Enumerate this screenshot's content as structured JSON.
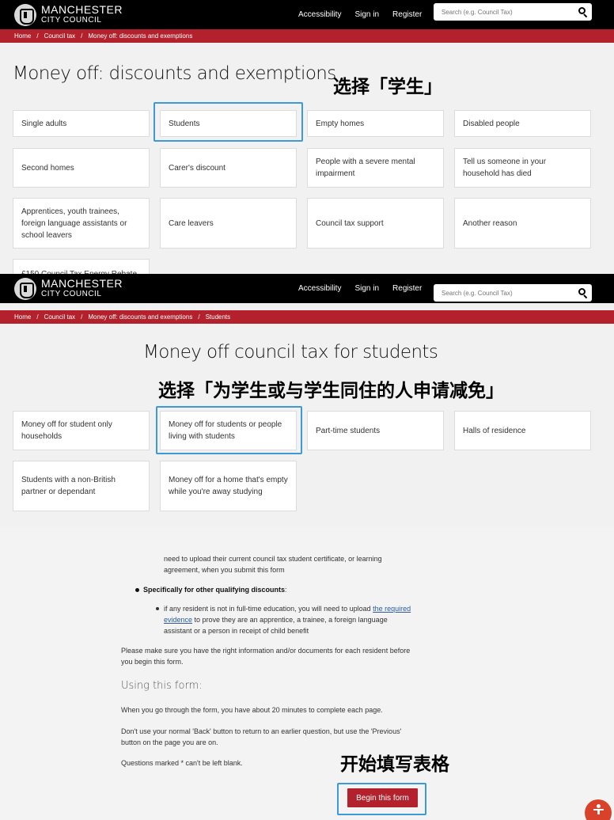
{
  "header": {
    "logo_line1": "MANCHESTER",
    "logo_line2": "CITY COUNCIL",
    "nav": [
      "Accessibility",
      "Sign in",
      "Register"
    ],
    "search_placeholder": "Search (e.g. Council Tax)"
  },
  "screen1": {
    "breadcrumb": [
      "Home",
      "Council tax",
      "Money off: discounts and exemptions"
    ],
    "title": "Money off: discounts and exemptions",
    "annotation": "选择「学生」",
    "cards": [
      "Single adults",
      "Students",
      "Empty homes",
      "Disabled people",
      "Second homes",
      "Carer's discount",
      "People with a severe mental impairment",
      "Tell us someone in your household has died",
      "Apprentices, youth trainees, foreign language assistants or school leavers",
      "Care leavers",
      "Council tax support",
      "Another reason",
      "£150 Council Tax Energy Rebate"
    ]
  },
  "screen2": {
    "breadcrumb": [
      "Home",
      "Council tax",
      "Money off: discounts and exemptions",
      "Students"
    ],
    "title": "Money off council tax for students",
    "annotation": "选择「为学生或与学生同住的人申请减免」",
    "cards": [
      "Money off for student only households",
      "Money off for students or people living with students",
      "Part-time students",
      "Halls of residence",
      "Students with a non-British partner or dependant",
      "Money off for a home that's empty while you're away studying"
    ]
  },
  "screen3": {
    "upload_text": "need to upload their current council tax student certificate, or learning agreement, when you submit this form",
    "other_heading": "Specifically for other qualifying discounts",
    "other_colon": ":",
    "other_pre": "if any resident is not in full-time education, you will need to upload ",
    "other_link": "the required evidence",
    "other_post": " to prove they are an apprentice, a trainee, a foreign language assistant or a person in receipt of child benefit",
    "prepare_text": "Please make sure you have the right information and/or documents for each resident before you begin this form.",
    "using_heading": "Using this form:",
    "time_text": "When you go through the form, you have about 20 minutes to complete each page.",
    "back_text": "Don't use your normal 'Back' button to return to an earlier question, but use the 'Previous' button on the page you are on.",
    "required_text": "Questions marked * can't be left blank.",
    "annotation": "开始填写表格",
    "begin_button": "Begin this form"
  }
}
